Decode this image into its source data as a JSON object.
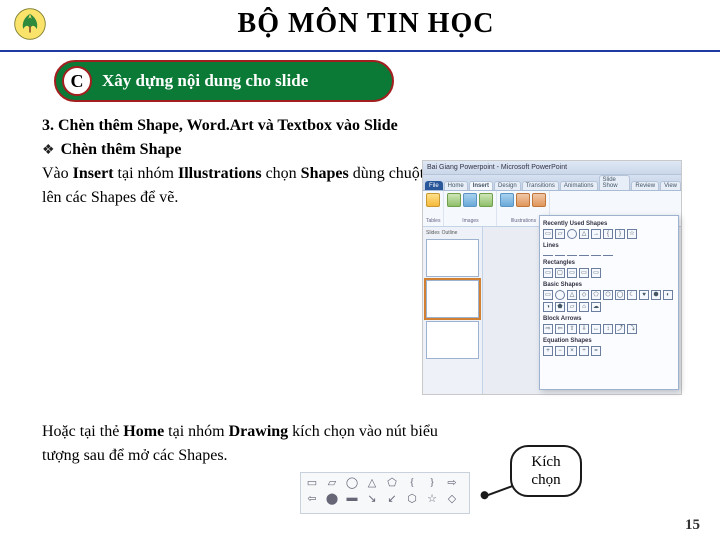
{
  "header": {
    "title": "BỘ MÔN TIN HỌC",
    "logo_name": "school-logo"
  },
  "section": {
    "letter": "C",
    "title": "Xây dựng nội dung cho slide"
  },
  "content": {
    "heading": "3. Chèn thêm Shape, Word.Art và Textbox vào Slide",
    "bullet": "Chèn thêm Shape",
    "para1_a": "Vào ",
    "para1_b": "Insert",
    "para1_c": " tại nhóm ",
    "para1_d": "Illustrations",
    "para1_e": " chọn ",
    "para1_f": "Shapes",
    "para1_g": " dùng chuột chọn lên các Shapes để vẽ."
  },
  "lower": {
    "para2_a": "Hoặc tại thẻ ",
    "para2_b": "Home",
    "para2_c": " tại nhóm ",
    "para2_d": "Drawing",
    "para2_e": " kích chọn vào nút biểu tượng sau để mở các Shapes."
  },
  "callout": {
    "line1": "Kích",
    "line2": "chọn"
  },
  "powerpoint": {
    "titlebar": "Bai Giang Powerpoint - Microsoft PowerPoint",
    "tabs": {
      "file": "File",
      "home": "Home",
      "insert": "Insert",
      "design": "Design",
      "transitions": "Transitions",
      "animations": "Animations",
      "slideshow": "Slide Show",
      "review": "Review",
      "view": "View"
    },
    "groups": {
      "tables": "Tables",
      "images": "Images",
      "illustrations": "Illustrations"
    },
    "thumbs_tabs": {
      "slides": "Slides",
      "outline": "Outline"
    },
    "dropdown": {
      "recent": "Recently Used Shapes",
      "lines": "Lines",
      "rectangles": "Rectangles",
      "basic": "Basic Shapes",
      "block": "Block Arrows",
      "equation": "Equation Shapes"
    }
  },
  "drawing_shapes": [
    "▭",
    "▱",
    "◯",
    "△",
    "⬠",
    "{",
    "}",
    "⇨",
    "⇦",
    "⬤",
    "▬",
    "↘",
    "↙",
    "⬡",
    "☆",
    "◇"
  ],
  "page_number": "15"
}
